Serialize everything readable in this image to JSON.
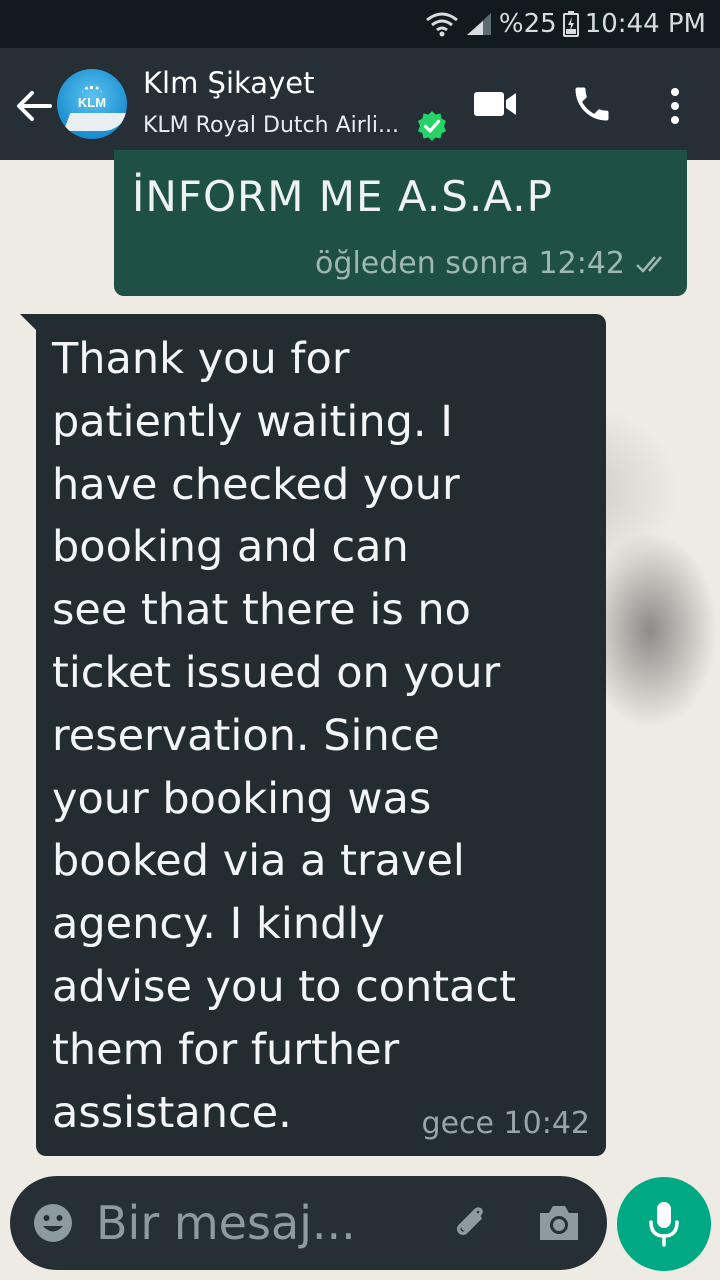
{
  "status_bar": {
    "battery": "%25",
    "time": "10:44 PM",
    "icons": [
      "wifi-icon",
      "signal-icon",
      "battery-icon"
    ]
  },
  "header": {
    "contact_name": "Klm Şikayet",
    "contact_subtitle": "KLM Royal Dutch Airli...",
    "avatar_logo": "KLM",
    "icons": [
      "back-arrow-icon",
      "verified-badge-icon",
      "video-call-icon",
      "phone-icon",
      "more-vert-icon"
    ]
  },
  "messages": [
    {
      "direction": "outgoing",
      "text": "İNFORM ME A.S.A.P",
      "time": "öğleden sonra 12:42",
      "status_icon": "double-check-icon"
    },
    {
      "direction": "incoming",
      "text": "Thank you for\npatiently waiting. I\nhave checked your\nbooking and can\nsee that there is no\nticket issued on your\nreservation. Since\nyour booking was\nbooked via a travel\nagency. I kindly\nadvise you to contact\nthem for further\nassistance.",
      "time": "gece 10:42"
    }
  ],
  "composer": {
    "placeholder": "Bir mesaj...",
    "icons": [
      "emoji-icon",
      "attach-icon",
      "camera-icon",
      "mic-icon"
    ]
  },
  "colors": {
    "status_bar": "#111a1f",
    "header": "#252f35",
    "outgoing_bubble": "#1e5046",
    "incoming_bubble": "#222c31",
    "accent": "#00a884",
    "verified": "#25d366"
  }
}
